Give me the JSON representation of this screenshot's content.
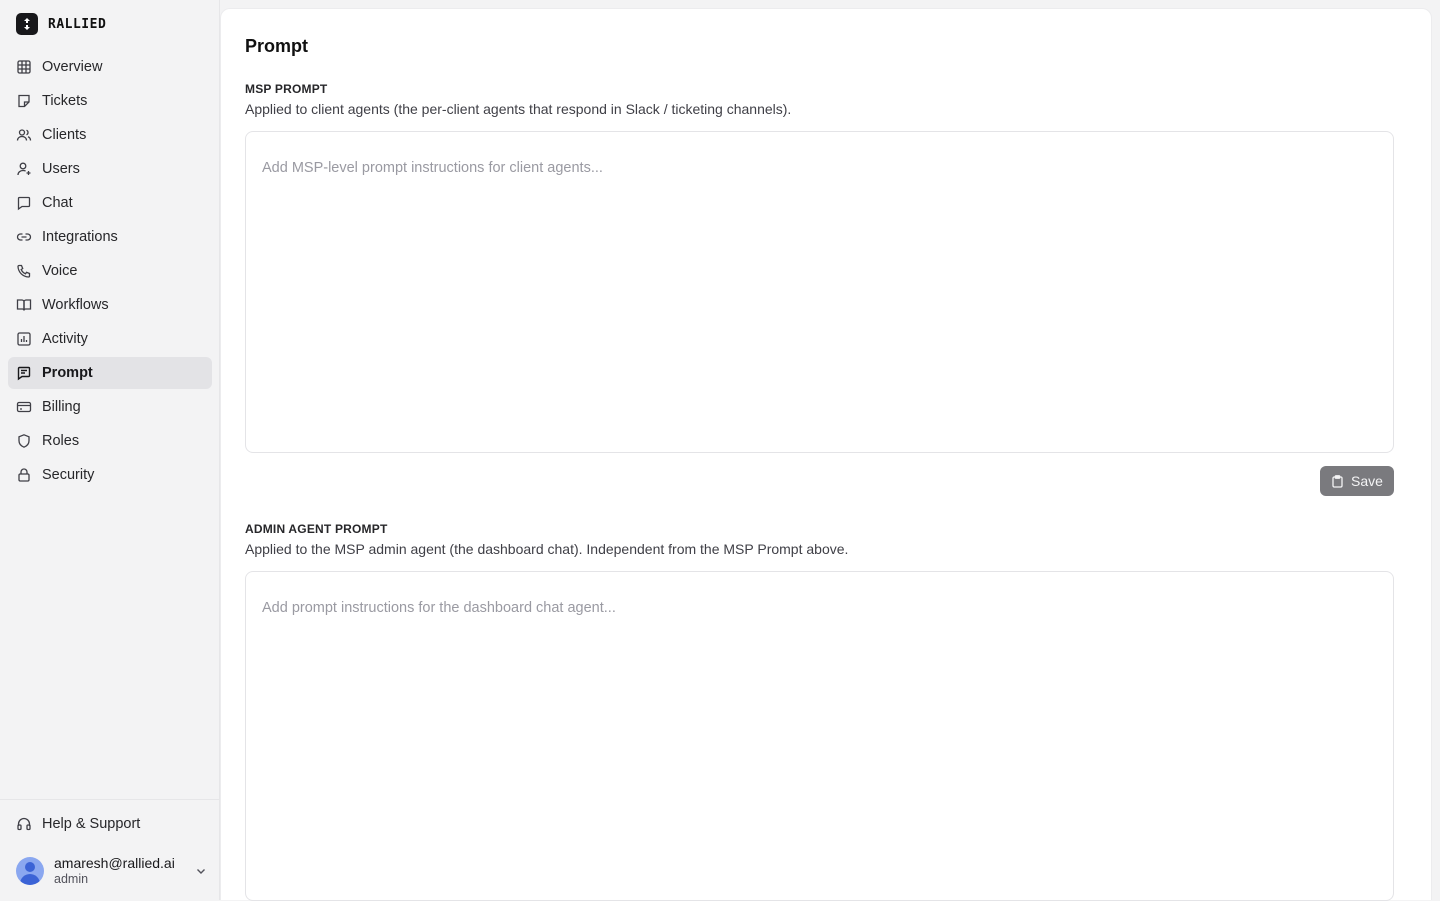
{
  "brand": {
    "name": "RALLIED"
  },
  "sidebar": {
    "items": [
      {
        "label": "Overview",
        "icon": "grid-icon"
      },
      {
        "label": "Tickets",
        "icon": "sticky-note-icon"
      },
      {
        "label": "Clients",
        "icon": "users-icon"
      },
      {
        "label": "Users",
        "icon": "user-icon"
      },
      {
        "label": "Chat",
        "icon": "chat-bubble-icon"
      },
      {
        "label": "Integrations",
        "icon": "link-icon"
      },
      {
        "label": "Voice",
        "icon": "phone-icon"
      },
      {
        "label": "Workflows",
        "icon": "book-open-icon"
      },
      {
        "label": "Activity",
        "icon": "bar-chart-icon"
      },
      {
        "label": "Prompt",
        "icon": "message-text-icon",
        "active": true
      },
      {
        "label": "Billing",
        "icon": "credit-card-icon"
      },
      {
        "label": "Roles",
        "icon": "shield-icon"
      },
      {
        "label": "Security",
        "icon": "lock-icon"
      }
    ],
    "help_label": "Help & Support",
    "user": {
      "email": "amaresh@rallied.ai",
      "role": "admin"
    }
  },
  "main": {
    "title": "Prompt",
    "msp": {
      "label": "MSP PROMPT",
      "description": "Applied to client agents (the per-client agents that respond in Slack / ticketing channels).",
      "value": "",
      "placeholder": "Add MSP-level prompt instructions for client agents..."
    },
    "save_label": "Save",
    "admin": {
      "label": "ADMIN AGENT PROMPT",
      "description": "Applied to the MSP admin agent (the dashboard chat). Independent from the MSP Prompt above.",
      "value": "",
      "placeholder": "Add prompt instructions for the dashboard chat agent..."
    }
  },
  "colors": {
    "active_nav_bg": "#e3e3e6",
    "save_button_bg": "#7a7a7e",
    "avatar_bg": "#8aa7f0"
  }
}
